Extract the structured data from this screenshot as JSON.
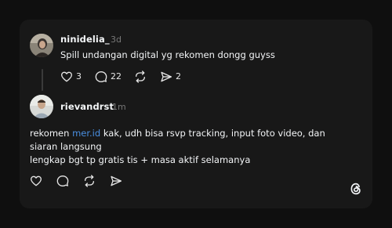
{
  "post": {
    "username": "ninidelia_",
    "time": "3d",
    "text": "Spill undangan digital yg rekomen dongg guyss",
    "avatar_icon": "user-photo-avatar",
    "actions": {
      "like_count": "3",
      "reply_count": "22",
      "repost_count": "",
      "share_count": "2"
    }
  },
  "reply": {
    "username": "rievandrst",
    "time": "1m",
    "text_prefix": "rekomen ",
    "link_text": "mer.id",
    "text_line1_rest": " kak, udh bisa rsvp tracking, input foto video, dan",
    "text_line2": "siaran langsung",
    "text_line3": "lengkap bgt tp gratis tis + masa aktif selamanya",
    "avatar_icon": "user-photo-avatar"
  },
  "colors": {
    "background": "#0f0f0f",
    "card": "#181818",
    "text": "#f3f5f7",
    "muted": "#777777",
    "link": "#4a90e2"
  },
  "brand_icon": "threads-logo-icon"
}
